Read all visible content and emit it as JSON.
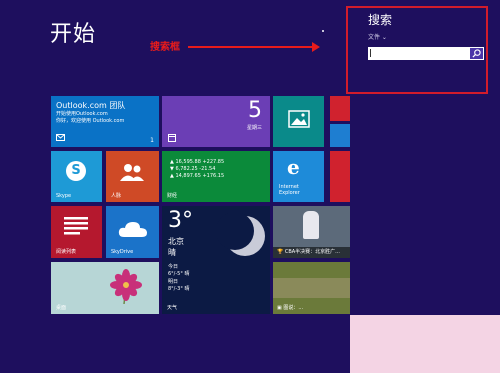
{
  "start": {
    "title": "开始"
  },
  "annotation": {
    "label": "搜索框"
  },
  "search": {
    "title": "搜索",
    "scope": "文件 ⌄",
    "value": ""
  },
  "tiles": {
    "outlook": {
      "title": "Outlook.com 团队",
      "line1": "开始使用Outlook.com",
      "line2": "你好，欢迎使用 Outlook.com",
      "count": "1"
    },
    "calendar": {
      "day": "5",
      "weekday": "星期三"
    },
    "skype": {
      "label": "Skype"
    },
    "people": {
      "label": "人脉"
    },
    "finance": {
      "row1": "16,595.88 +227.85",
      "row2": "6,782.25 -21.54",
      "row3": "14,897.65 +176.15",
      "label": "财经"
    },
    "ie": {
      "line1": "Internet",
      "line2": "Explorer"
    },
    "reading": {
      "label": "阅读列表"
    },
    "skydrive": {
      "label": "SkyDrive"
    },
    "weather": {
      "temp": "3°",
      "city": "北京",
      "cond": "晴",
      "today": "今日",
      "today_val": "6°/-5° 晴",
      "tomorrow": "明日",
      "tomorrow_val": "8°/-3° 晴",
      "label": "天气"
    },
    "sports": {
      "headline": "CBA半决赛：北京胜广..."
    },
    "desktop": {
      "label": "桌面"
    },
    "news": {
      "headline": "图说：..."
    }
  },
  "colors": {
    "background": "#1e0f5e",
    "highlight": "#d21c2b"
  }
}
